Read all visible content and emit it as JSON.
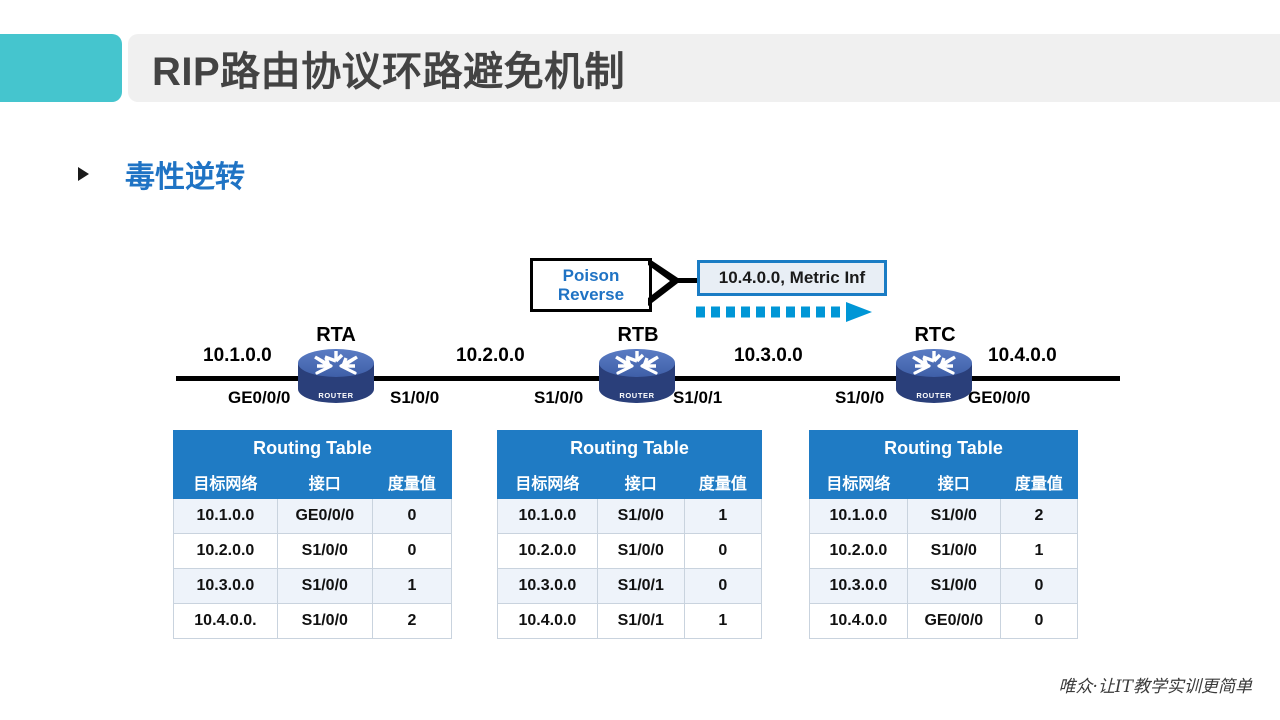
{
  "header": {
    "title": "RIP路由协议环路避免机制",
    "teal_color": "#45c5ce",
    "bar_color": "#f0f0f0"
  },
  "bullet": {
    "text": "毒性逆转",
    "color": "#1f73c4"
  },
  "callout": {
    "line1": "Poison",
    "line2": "Reverse",
    "text_color": "#1f73c4",
    "border_color": "#000000"
  },
  "metric_box": {
    "text": "10.4.0.0, Metric Inf",
    "fill": "#e8eef5",
    "border": "#1a7cc4"
  },
  "arrow": {
    "name": "dashed-right-arrow",
    "color": "#0096d6",
    "direction": "right"
  },
  "topology": {
    "routers": [
      {
        "name": "RTA",
        "icon": "router-icon",
        "caption": "ROUTER"
      },
      {
        "name": "RTB",
        "icon": "router-icon",
        "caption": "ROUTER"
      },
      {
        "name": "RTC",
        "icon": "router-icon",
        "caption": "ROUTER"
      }
    ],
    "networks": [
      "10.1.0.0",
      "10.2.0.0",
      "10.3.0.0",
      "10.4.0.0"
    ],
    "interfaces": {
      "rta_left": "GE0/0/0",
      "rta_right": "S1/0/0",
      "rtb_left": "S1/0/0",
      "rtb_right": "S1/0/1",
      "rtc_left": "S1/0/0",
      "rtc_right": "GE0/0/0"
    }
  },
  "tables": [
    {
      "title": "Routing Table",
      "columns": [
        "目标网络",
        "接口",
        "度量值"
      ],
      "rows": [
        [
          "10.1.0.0",
          "GE0/0/0",
          "0"
        ],
        [
          "10.2.0.0",
          "S1/0/0",
          "0"
        ],
        [
          "10.3.0.0",
          "S1/0/0",
          "1"
        ],
        [
          "10.4.0.0.",
          "S1/0/0",
          "2"
        ]
      ]
    },
    {
      "title": "Routing Table",
      "columns": [
        "目标网络",
        "接口",
        "度量值"
      ],
      "rows": [
        [
          "10.1.0.0",
          "S1/0/0",
          "1"
        ],
        [
          "10.2.0.0",
          "S1/0/0",
          "0"
        ],
        [
          "10.3.0.0",
          "S1/0/1",
          "0"
        ],
        [
          "10.4.0.0",
          "S1/0/1",
          "1"
        ]
      ]
    },
    {
      "title": "Routing Table",
      "columns": [
        "目标网络",
        "接口",
        "度量值"
      ],
      "rows": [
        [
          "10.1.0.0",
          "S1/0/0",
          "2"
        ],
        [
          "10.2.0.0",
          "S1/0/0",
          "1"
        ],
        [
          "10.3.0.0",
          "S1/0/0",
          "0"
        ],
        [
          "10.4.0.0",
          "GE0/0/0",
          "0"
        ]
      ]
    }
  ],
  "footer": {
    "text": "唯众·让IT教学实训更简单"
  }
}
